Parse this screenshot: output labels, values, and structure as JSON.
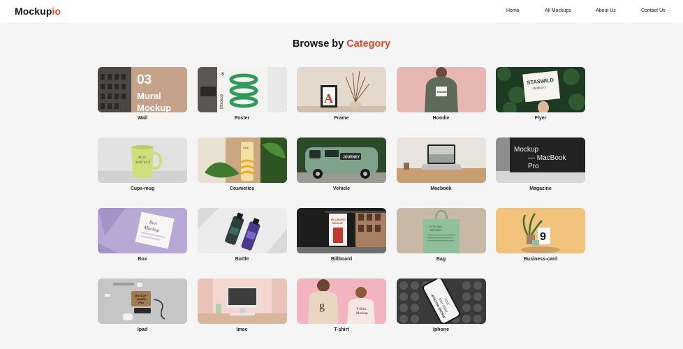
{
  "header": {
    "logo_main": "Mockup",
    "logo_accent": "io",
    "nav": [
      "Home",
      "All Mockups",
      "About Us",
      "Contact Us"
    ]
  },
  "heading": {
    "prefix": "Browse by",
    "accent": "Category"
  },
  "categories": [
    {
      "label": "Wall",
      "icon": "wall-mural-image"
    },
    {
      "label": "Poster",
      "icon": "poster-image"
    },
    {
      "label": "Frame",
      "icon": "frame-image"
    },
    {
      "label": "Hoodie",
      "icon": "hoodie-image"
    },
    {
      "label": "Flyer",
      "icon": "flyer-image"
    },
    {
      "label": "Cups-mug",
      "icon": "mug-image"
    },
    {
      "label": "Cosmetics",
      "icon": "cosmetics-image"
    },
    {
      "label": "Vehicle",
      "icon": "vehicle-image"
    },
    {
      "label": "Macbook",
      "icon": "macbook-image"
    },
    {
      "label": "Magazine",
      "icon": "magazine-image"
    },
    {
      "label": "Box",
      "icon": "box-image"
    },
    {
      "label": "Bottle",
      "icon": "bottle-image"
    },
    {
      "label": "Billboard",
      "icon": "billboard-image"
    },
    {
      "label": "Bag",
      "icon": "bag-image"
    },
    {
      "label": "Business-card",
      "icon": "business-card-image"
    },
    {
      "label": "Ipad",
      "icon": "ipad-image"
    },
    {
      "label": "Imac",
      "icon": "imac-image"
    },
    {
      "label": "T-shirt",
      "icon": "tshirt-image"
    },
    {
      "label": "Iphone",
      "icon": "iphone-image"
    }
  ],
  "thumb_text": {
    "wall": [
      "03",
      "Mural",
      "Mockup"
    ],
    "poster": "S",
    "poster_side": "Mockup",
    "frame": "A",
    "hoodie": "HOODIE",
    "flyer": [
      "STASWILD",
      "Outdoors"
    ],
    "mug": [
      "MUG",
      "MOCKUP"
    ],
    "cosmetics": "Tube",
    "vehicle": "JOURNEY",
    "magazine": [
      "Mockup",
      "— MacBook",
      "Pro"
    ],
    "box": [
      "Box",
      "Mockup"
    ],
    "billboard": [
      "BILLBOARD",
      "MOCKUP"
    ],
    "bag": [
      "TOTE BAG",
      "MOCKUP"
    ],
    "card": "9",
    "ipad": [
      "MOCKUP",
      "SMART",
      "PRO"
    ],
    "tshirt_left": "g",
    "tshirt_right": [
      "T-Shirt",
      "Mockup"
    ],
    "iphone": [
      "IPHONE MOCKUP",
      "FREE PSD",
      "2023"
    ]
  },
  "colors": {
    "accent": "#e8451e",
    "background": "#f5f5f5",
    "header": "#ffffff"
  }
}
